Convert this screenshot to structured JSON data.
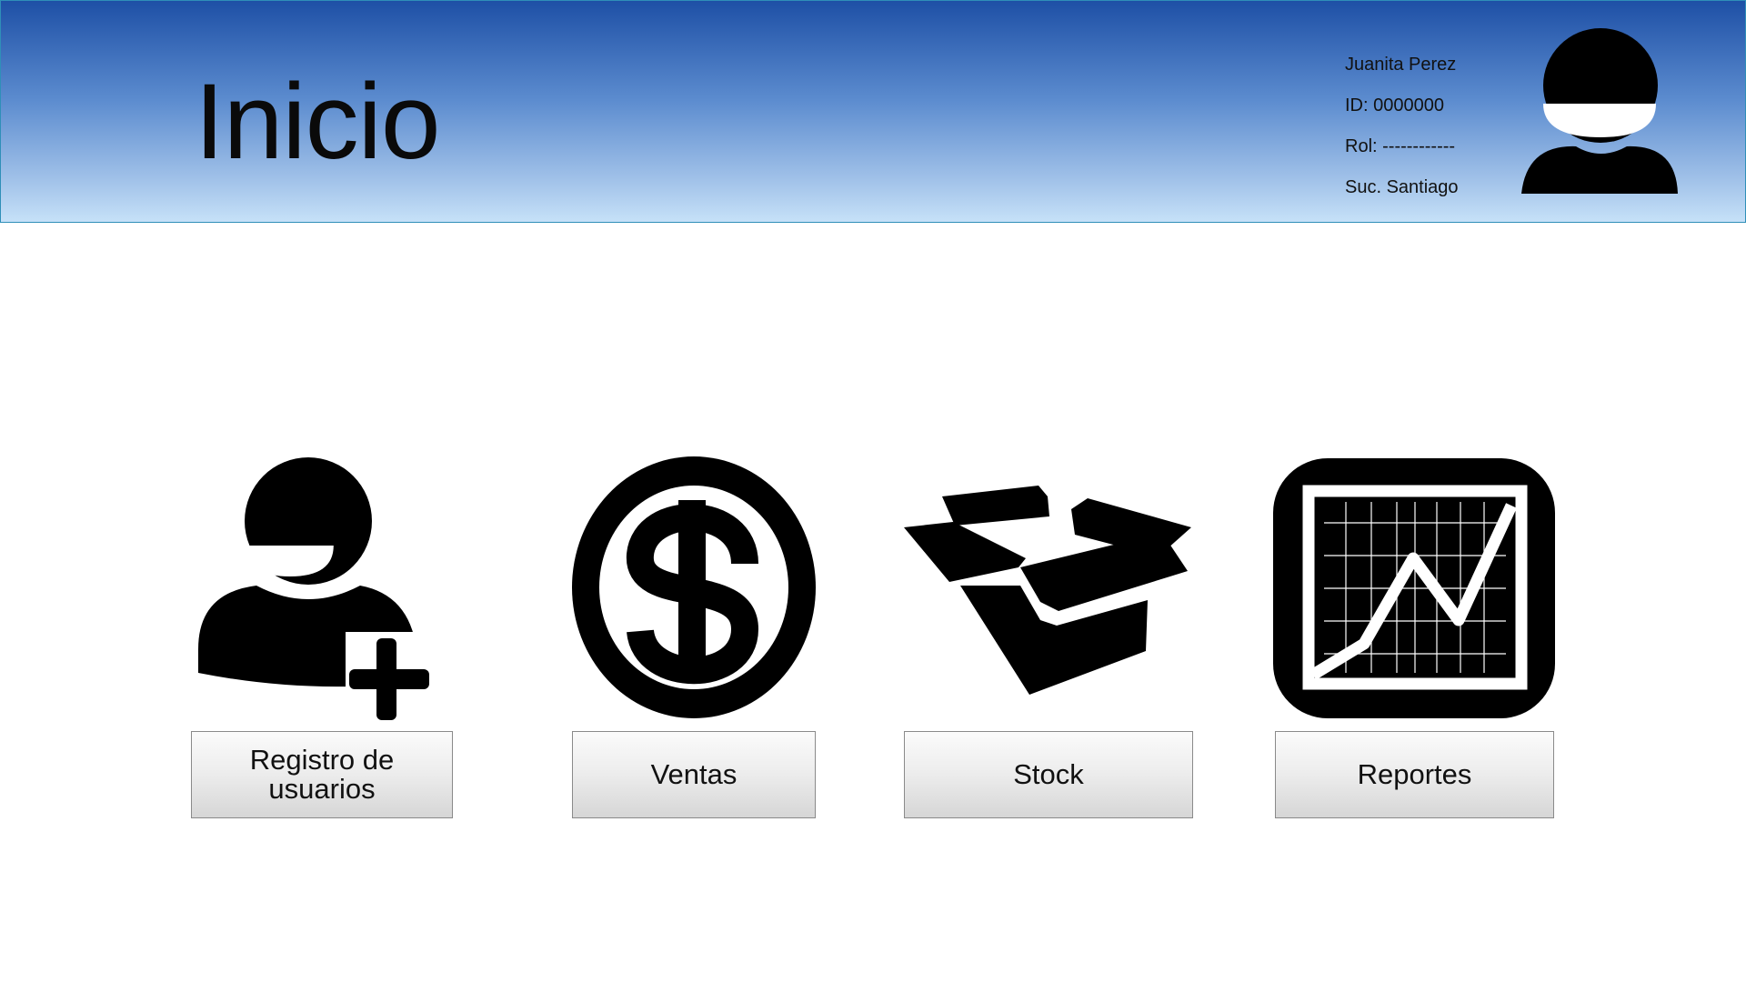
{
  "header": {
    "title": "Inicio",
    "user": {
      "name": "Juanita Perez",
      "id": "ID: 0000000",
      "role": "Rol: ------------",
      "branch": "Suc. Santiago"
    },
    "avatar_icon": "user-avatar-icon"
  },
  "tiles": [
    {
      "icon": "add-user-icon",
      "label": "Registro de usuarios"
    },
    {
      "icon": "dollar-coin-icon",
      "label": "Ventas"
    },
    {
      "icon": "open-box-icon",
      "label": "Stock"
    },
    {
      "icon": "line-chart-icon",
      "label": "Reportes"
    }
  ],
  "colors": {
    "header_top": "#1e50a6",
    "header_bottom": "#c6e1f8",
    "header_border": "#2f8fb8",
    "icon": "#000000",
    "button_border": "#8a8a8a"
  }
}
